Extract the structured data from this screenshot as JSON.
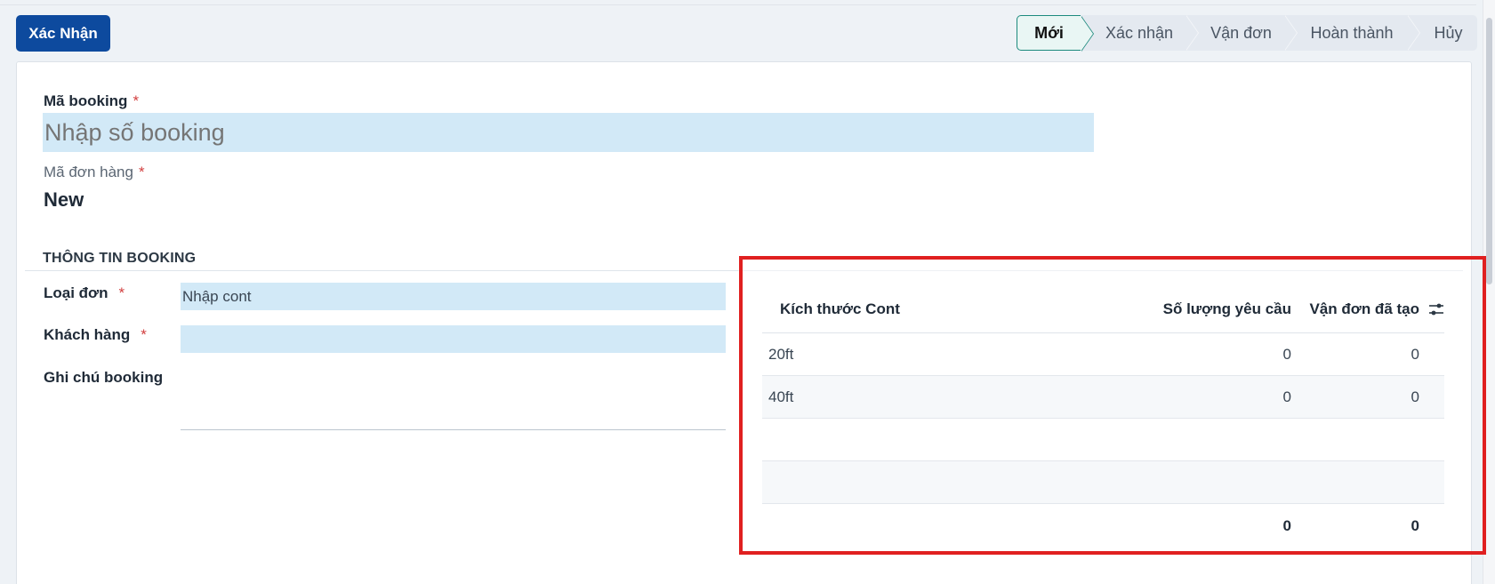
{
  "toolbar": {
    "confirm_label": "Xác Nhận"
  },
  "status_steps": [
    {
      "label": "Mới",
      "active": true
    },
    {
      "label": "Xác nhận",
      "active": false
    },
    {
      "label": "Vận đơn",
      "active": false
    },
    {
      "label": "Hoàn thành",
      "active": false
    },
    {
      "label": "Hủy",
      "active": false
    }
  ],
  "form": {
    "booking_code": {
      "label": "Mã booking",
      "required_mark": "*",
      "placeholder": "Nhập số booking",
      "value": ""
    },
    "order_code": {
      "label": "Mã đơn hàng",
      "required_mark": "*",
      "value": "New"
    },
    "section_title": "THÔNG TIN BOOKING",
    "order_type": {
      "label": "Loại đơn",
      "required_mark": "*",
      "value": "Nhập cont"
    },
    "customer": {
      "label": "Khách hàng",
      "required_mark": "*",
      "value": ""
    },
    "note": {
      "label": "Ghi chú booking",
      "value": ""
    }
  },
  "table": {
    "headers": [
      "Kích thước Cont",
      "Số lượng yêu cầu",
      "Vận đơn đã tạo"
    ],
    "rows": [
      {
        "size": "20ft",
        "requested": "0",
        "created": "0"
      },
      {
        "size": "40ft",
        "requested": "0",
        "created": "0"
      }
    ],
    "totals": {
      "requested": "0",
      "created": "0"
    },
    "settings_icon": "sliders-icon"
  },
  "colors": {
    "primary": "#0d4a9e",
    "active_step": "#1c8a7d",
    "input_bg": "#d2e9f7",
    "required": "#d23f3f",
    "highlight": "#e02020"
  }
}
